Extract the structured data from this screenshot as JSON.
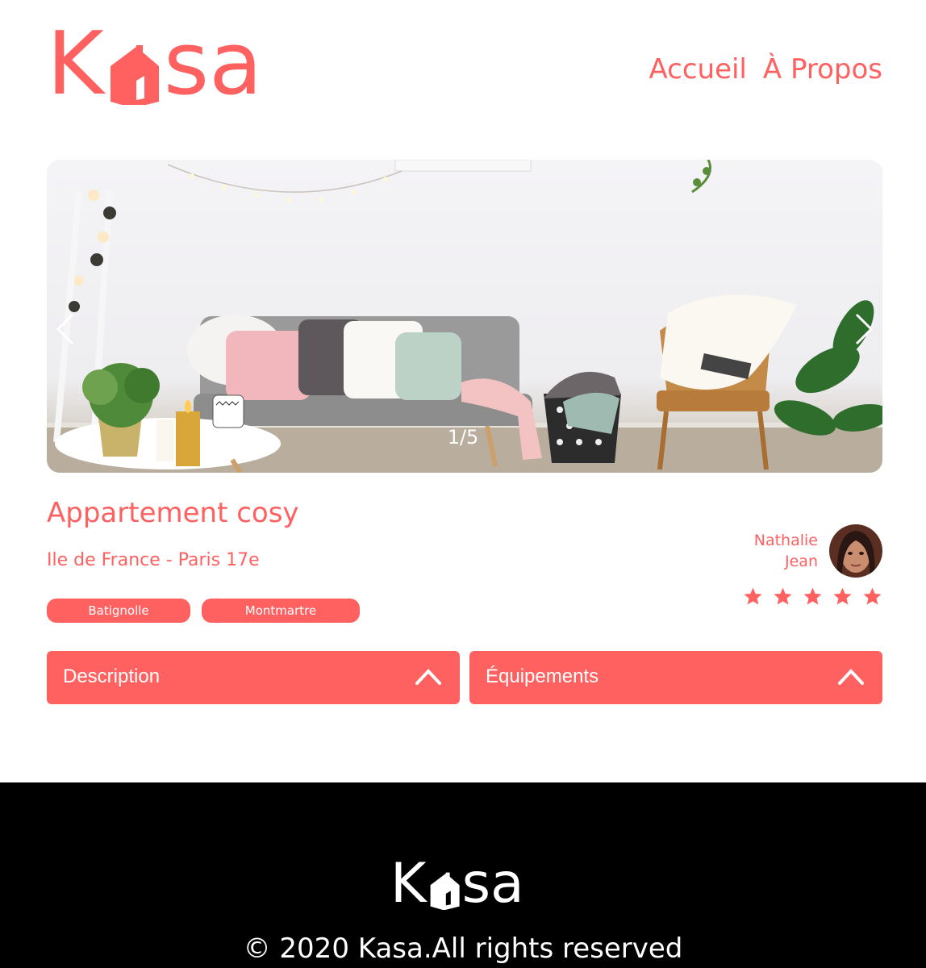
{
  "header": {
    "logo": {
      "letters": [
        "K",
        "s",
        "a"
      ],
      "icon": "house-icon"
    },
    "nav": [
      {
        "label": "Accueil"
      },
      {
        "label": "À Propos"
      }
    ]
  },
  "gallery": {
    "counter": "1/5",
    "prev_icon": "chevron-left-icon",
    "next_icon": "chevron-right-icon"
  },
  "listing": {
    "title": "Appartement cosy",
    "location": "Ile de France - Paris 17e",
    "tags": [
      "Batignolle",
      "Montmartre"
    ]
  },
  "host": {
    "first_name": "Nathalie",
    "last_name": "Jean",
    "rating": 5,
    "rating_max": 5
  },
  "collapses": [
    {
      "label": "Description",
      "icon": "chevron-up-icon"
    },
    {
      "label": "Équipements",
      "icon": "chevron-up-icon"
    }
  ],
  "footer": {
    "copyright": "© 2020 Kasa.All rights reserved"
  },
  "colors": {
    "accent": "#ff6060",
    "footer_bg": "#000000",
    "white": "#ffffff"
  }
}
